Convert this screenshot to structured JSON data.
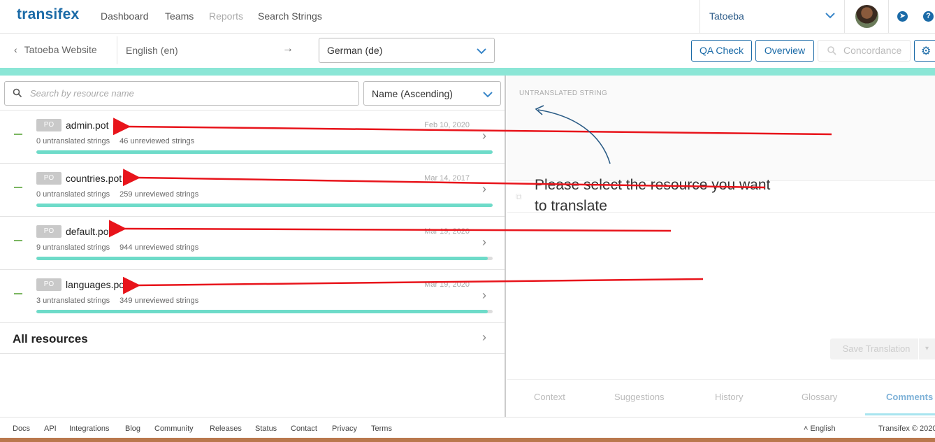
{
  "topnav": {
    "logo": "transifex",
    "links": [
      "Dashboard",
      "Teams",
      "Reports",
      "Search Strings"
    ],
    "org": "Tatoeba"
  },
  "subbar": {
    "back": "Tatoeba Website",
    "source_lang": "English (en)",
    "arrow": "→",
    "target_lang": "German (de)",
    "qa_check": "QA Check",
    "overview": "Overview",
    "concordance": "Concordance"
  },
  "left": {
    "search_placeholder": "Search by resource name",
    "sort": "Name (Ascending)",
    "resources": [
      {
        "badge": "PO",
        "name": "admin.pot",
        "date": "Feb 10, 2020",
        "untranslated": "0 untranslated strings",
        "unreviewed": "46 unreviewed strings",
        "progress": 1.0
      },
      {
        "badge": "PO",
        "name": "countries.pot",
        "date": "Mar 14, 2017",
        "untranslated": "0 untranslated strings",
        "unreviewed": "259 unreviewed strings",
        "progress": 1.0
      },
      {
        "badge": "PO",
        "name": "default.pot",
        "date": "Mar 19, 2020",
        "untranslated": "9 untranslated strings",
        "unreviewed": "944 unreviewed strings",
        "progress": 0.99
      },
      {
        "badge": "PO",
        "name": "languages.pot",
        "date": "Mar 19, 2020",
        "untranslated": "3 untranslated strings",
        "unreviewed": "349 unreviewed strings",
        "progress": 0.99
      }
    ],
    "all_resources": "All resources"
  },
  "right": {
    "untranslated_title": "UNTRANSLATED STRING",
    "message": "Please select the resource you want to translate",
    "save": "Save Translation",
    "tabs": [
      "Context",
      "Suggestions",
      "History",
      "Glossary",
      "Comments"
    ]
  },
  "footer": {
    "links": [
      "Docs",
      "API",
      "Integrations",
      "Blog",
      "Community",
      "Releases",
      "Status",
      "Contact",
      "Privacy",
      "Terms"
    ],
    "language": "English",
    "copyright": "Transifex © 2020"
  },
  "colors": {
    "brand": "#1a6aa7",
    "progress": "#6edbc9",
    "annotation": "#e8141b"
  }
}
